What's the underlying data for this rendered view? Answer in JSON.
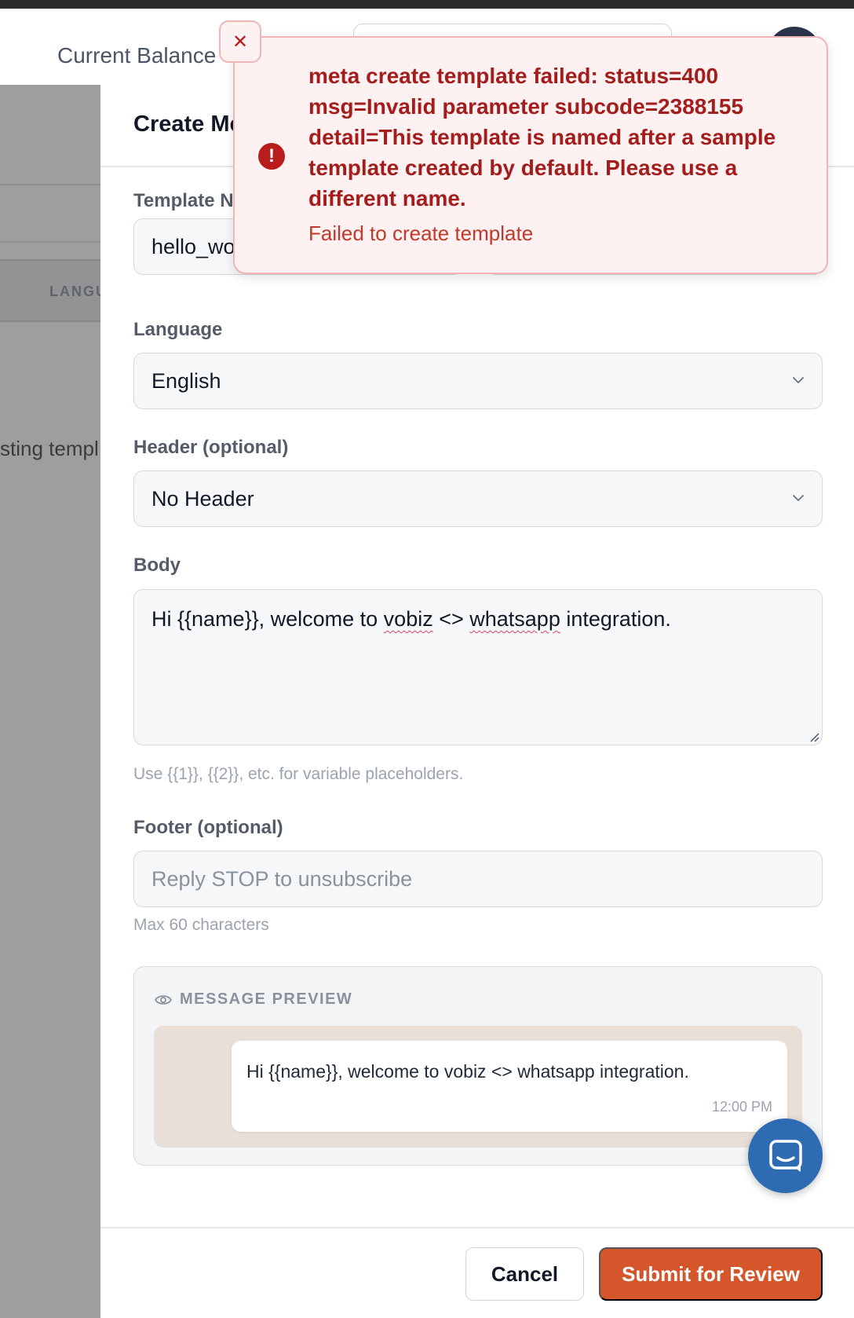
{
  "topbar": {
    "balance_label": "Current Balance"
  },
  "background": {
    "column_header": "LANGU",
    "row_text": "sting templ"
  },
  "panel": {
    "title": "Create Me",
    "template_name": {
      "label": "Template N",
      "value": "hello_wor"
    },
    "language": {
      "label": "Language",
      "value": "English"
    },
    "header": {
      "label": "Header (optional)",
      "value": "No Header"
    },
    "body": {
      "label": "Body",
      "text_parts": [
        "Hi {{name}}, welcome to ",
        "vobiz",
        " <> ",
        "whatsapp",
        " integration."
      ],
      "hint": "Use {{1}}, {{2}}, etc. for variable placeholders."
    },
    "footer": {
      "label": "Footer (optional)",
      "placeholder": "Reply STOP to unsubscribe",
      "hint": "Max 60 characters"
    },
    "preview": {
      "heading": "MESSAGE PREVIEW",
      "message": "Hi {{name}}, welcome to vobiz <> whatsapp integration.",
      "time": "12:00 PM"
    },
    "actions": {
      "cancel": "Cancel",
      "submit": "Submit for Review"
    }
  },
  "toast": {
    "message": "meta create template failed: status=400 msg=Invalid parameter subcode=2388155 detail=This template is named after a sample template created by default. Please use a different name.",
    "subtitle": "Failed to create template",
    "icon": "alert-circle-icon",
    "close_icon": "close-icon"
  },
  "colors": {
    "accent": "#d5562a",
    "error": "#a31d1d",
    "error_bg": "#fdf1f1",
    "launcher": "#2d6cb3"
  }
}
